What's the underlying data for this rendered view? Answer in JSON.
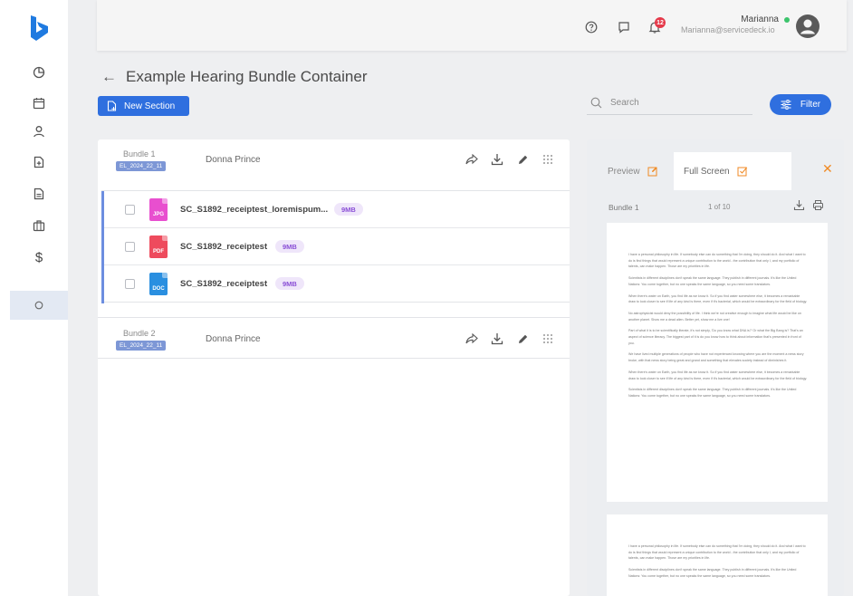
{
  "sidebar": {
    "logo_icon": "bing-logo",
    "items": [
      {
        "icon": "dashboard-icon"
      },
      {
        "icon": "calendar-icon"
      },
      {
        "icon": "user-icon"
      },
      {
        "icon": "file-add-icon"
      },
      {
        "icon": "document-icon"
      },
      {
        "icon": "briefcase-icon"
      },
      {
        "icon": "dollar-icon",
        "glyph": "$"
      },
      {
        "icon": "circle-icon"
      }
    ]
  },
  "topbar": {
    "notification_count": "12",
    "user_name": "Marianna",
    "user_email": "Marianna@servicedeck.io",
    "status_color": "#3cc46c"
  },
  "page": {
    "back_glyph": "←",
    "title": "Example Hearing Bundle Container",
    "new_section_label": "New Section",
    "search_placeholder": "Search",
    "filter_label": "Filter"
  },
  "bundles": [
    {
      "label": "Bundle 1",
      "tag": "EL_2024_22_11",
      "owner": "Donna Prince"
    },
    {
      "label": "Bundle 2",
      "tag": "EL_2024_22_11",
      "owner": "Donna Prince"
    }
  ],
  "files": [
    {
      "type": "JPG",
      "name": "SC_S1892_receiptest_loremispum...",
      "size": "9MB",
      "color": "#e84fcf"
    },
    {
      "type": "PDF",
      "name": "SC_S1892_receiptest",
      "size": "9MB",
      "color": "#ee4b5d"
    },
    {
      "type": "DOC",
      "name": "SC_S1892_receiptest",
      "size": "9MB",
      "color": "#2a8fe0"
    }
  ],
  "viewer": {
    "tab_preview": "Preview",
    "tab_fullscreen": "Full Screen",
    "close_glyph": "✕",
    "bundle_label": "Bundle 1",
    "page_indicator": "1 of 10",
    "page1_paragraphs": [
      "I have a personal philosophy in life. If somebody else can do something that I'm doing, they should do it. And what I want to do is find things that would represent a unique contribution to the world - the contribution that only I, and my portfolio of talents, can make happen. Those are my priorities in life.",
      "Scientists in different disciplines don't speak the same language. They publish in different journals. It's like the United Nations: You come together, but no one speaks the same language, so you need some translators.",
      "When there's water on Earth, you find life as we know it. So if you find water somewhere else, it becomes a remarkable draw to look closer to see if life of any kind is there, even if it's bacterial, which would be extraordinary for the field of biology.",
      "No astrophysicist would deny the possibility of life. I think we're not creative enough to imagine what life would be like on another planet. Show me a dead alien. Better yet, show me a live one!",
      "Part of what it is to be scientifically literate, it's not simply, 'Do you know what DNA is?' Or what the Big Bang is? That's an aspect of science literacy. The biggest part of it is do you know how to think about information that's presented in front of you.",
      "We have lived multiple generations of people who have not experienced knowing where you are the moment a news story broke, with that news story being great and grand and something that elevates society instead of diminishes it.",
      "When there's water on Earth, you find life as we know it. So if you find water somewhere else, it becomes a remarkable draw to look closer to see if life of any kind is there, even if it's bacterial, which would be extraordinary for the field of biology.",
      "Scientists in different disciplines don't speak the same language. They publish in different journals. It's like the United Nations: You come together, but no one speaks the same language, so you need some translators."
    ],
    "page2_paragraphs": [
      "I have a personal philosophy in life. If somebody else can do something that I'm doing, they should do it. And what I want to do is find things that would represent a unique contribution to the world - the contribution that only I, and my portfolio of talents, can make happen. Those are my priorities in life.",
      "Scientists in different disciplines don't speak the same language. They publish in different journals. It's like the United Nations: You come together, but no one speaks the same language, so you need some translators."
    ]
  },
  "colors": {
    "accent": "#2f6fdf",
    "orange": "#f08a24",
    "size_pill_bg": "#efe6fa",
    "size_pill_text": "#8a4fd6"
  }
}
